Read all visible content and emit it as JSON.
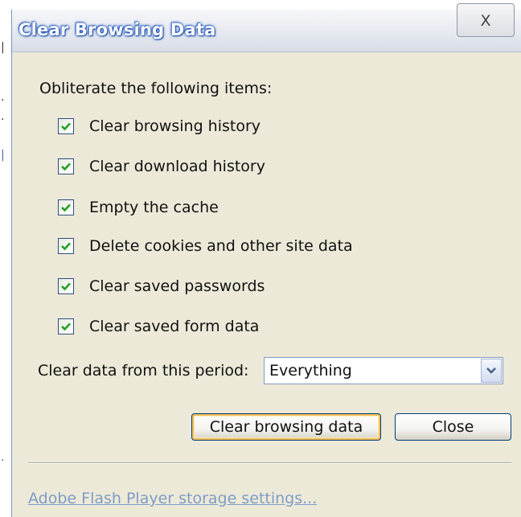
{
  "dialog": {
    "title": "Clear Browsing Data",
    "close_glyph": "X"
  },
  "options": {
    "heading": "Obliterate the following items:",
    "items": [
      {
        "label": "Clear browsing history",
        "checked": true
      },
      {
        "label": "Clear download history",
        "checked": true
      },
      {
        "label": "Empty the cache",
        "checked": true
      },
      {
        "label": "Delete cookies and other site data",
        "checked": true
      },
      {
        "label": "Clear saved passwords",
        "checked": true
      },
      {
        "label": "Clear saved form data",
        "checked": true
      }
    ]
  },
  "period": {
    "label": "Clear data from this period:",
    "selected": "Everything"
  },
  "buttons": {
    "clear_label": "Clear browsing data",
    "close_label": "Close"
  },
  "footer": {
    "flash_link": "Adobe Flash Player storage settings..."
  },
  "colors": {
    "title_text": "#ffffff",
    "title_glow": "#2a5cb8",
    "dialog_bg": "#ece9d8",
    "checkmark": "#21a121",
    "link": "#7f9cc6",
    "default_button_focus": "#f5c05a"
  },
  "icons": {
    "close": "close-x-icon",
    "checkbox_check": "checkmark-icon",
    "dropdown": "chevron-down-icon"
  }
}
